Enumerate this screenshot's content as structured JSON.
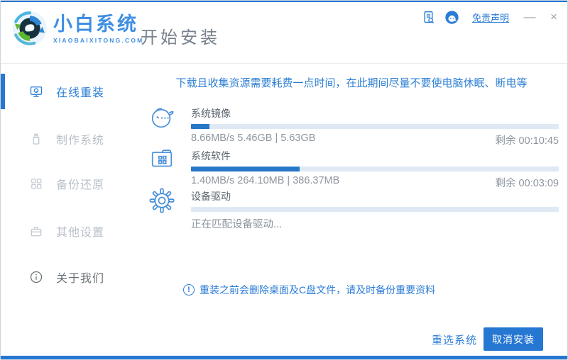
{
  "header": {
    "brand": "小白系统",
    "brand_domain": "XIAOBAIXITONG.COM",
    "page_title": "开始安装",
    "disclaimer_link": "免责声明",
    "minimize_label": "—",
    "close_label": "×"
  },
  "sidebar": {
    "items": [
      {
        "label": "在线重装",
        "icon": "monitor-icon",
        "active": true
      },
      {
        "label": "制作系统",
        "icon": "usb-icon",
        "active": false
      },
      {
        "label": "备份还原",
        "icon": "grid-icon",
        "active": false
      },
      {
        "label": "其他设置",
        "icon": "briefcase-icon",
        "active": false
      },
      {
        "label": "关于我们",
        "icon": "info-icon",
        "active": false
      }
    ]
  },
  "main": {
    "warning": "下载且收集资源需要耗费一点时间，在此期间尽量不要使电脑休眠、断电等",
    "sections": [
      {
        "title": "系统镜像",
        "icon": "face-icon",
        "stats": "8.66MB/s 5.46GB | 5.63GB",
        "remaining": "剩余 00:10:45",
        "percent": 5
      },
      {
        "title": "系统软件",
        "icon": "folder-icon",
        "stats": "1.40MB/s 264.10MB | 386.37MB",
        "remaining": "剩余 00:03:09",
        "percent": 29.5
      },
      {
        "title": "设备驱动",
        "icon": "gear-icon",
        "status": "正在匹配设备驱动...",
        "percent": 0
      }
    ],
    "notice_icon_glyph": "!",
    "notice": "重装之前会删除桌面及C盘文件，请及时备份重要资料"
  },
  "footer": {
    "reselect_label": "重选系统",
    "cancel_label": "取消安装"
  },
  "colors": {
    "accent": "#2677d2",
    "link_blue": "#2b7cd6",
    "bar_fill": "#2878c8",
    "bar_track": "#dfe9f6"
  }
}
